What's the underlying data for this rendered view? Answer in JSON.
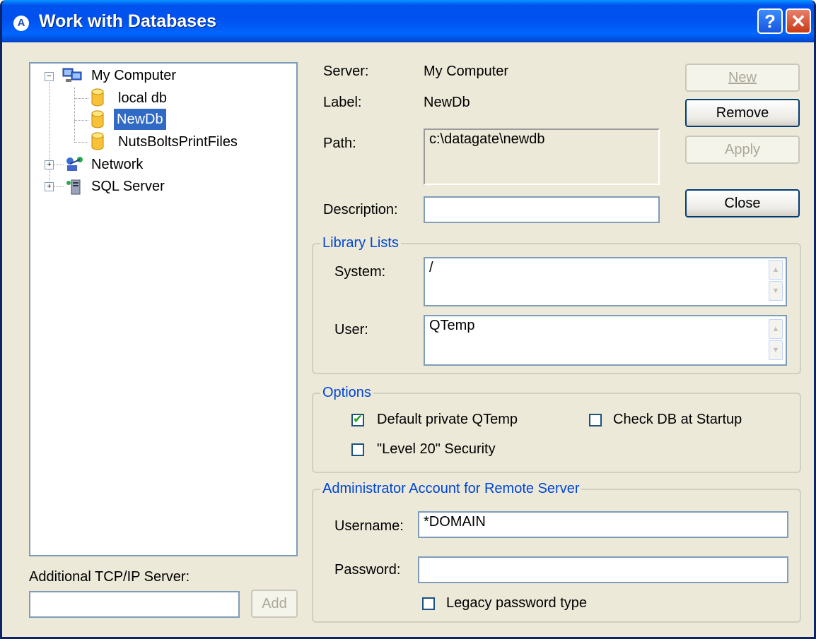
{
  "window": {
    "title": "Work with Databases",
    "app_icon": "A",
    "help_label": "?",
    "close_label": "✕"
  },
  "tree": {
    "root": {
      "label": "My Computer",
      "icon": "computer-icon"
    },
    "dbs": [
      {
        "label": "local db",
        "icon": "database-icon"
      },
      {
        "label": "NewDb",
        "icon": "database-icon",
        "selected": true
      },
      {
        "label": "NutsBoltsPrintFiles",
        "icon": "database-icon"
      }
    ],
    "network": {
      "label": "Network",
      "icon": "network-icon"
    },
    "sql": {
      "label": "SQL Server",
      "icon": "sql-server-icon"
    }
  },
  "additional": {
    "label": "Additional TCP/IP Server:",
    "value": "",
    "add_label": "Add"
  },
  "info": {
    "server_label": "Server:",
    "server_value": "My Computer",
    "label_label": "Label:",
    "label_value": "NewDb",
    "path_label": "Path:",
    "path_value": "c:\\datagate\\newdb",
    "description_label": "Description:",
    "description_value": ""
  },
  "buttons": {
    "new": "New",
    "remove": "Remove",
    "apply": "Apply",
    "close": "Close"
  },
  "library": {
    "title": "Library Lists",
    "system_label": "System:",
    "system_value": "/",
    "user_label": "User:",
    "user_value": "QTemp"
  },
  "options": {
    "title": "Options",
    "default_private": {
      "label": "Default private QTemp",
      "checked": true
    },
    "check_db": {
      "label": "Check DB at Startup",
      "checked": false
    },
    "level20": {
      "label": "\"Level 20\" Security",
      "checked": false
    }
  },
  "admin": {
    "title": "Administrator Account for Remote Server",
    "username_label": "Username:",
    "username_value": "*DOMAIN",
    "password_label": "Password:",
    "password_value": "",
    "legacy": {
      "label": "Legacy password type",
      "checked": false
    }
  },
  "colors": {
    "title_bar": "#0054E3",
    "dialog_bg": "#ECE9D8",
    "selection": "#316AC5",
    "group_title": "#0046D5"
  }
}
